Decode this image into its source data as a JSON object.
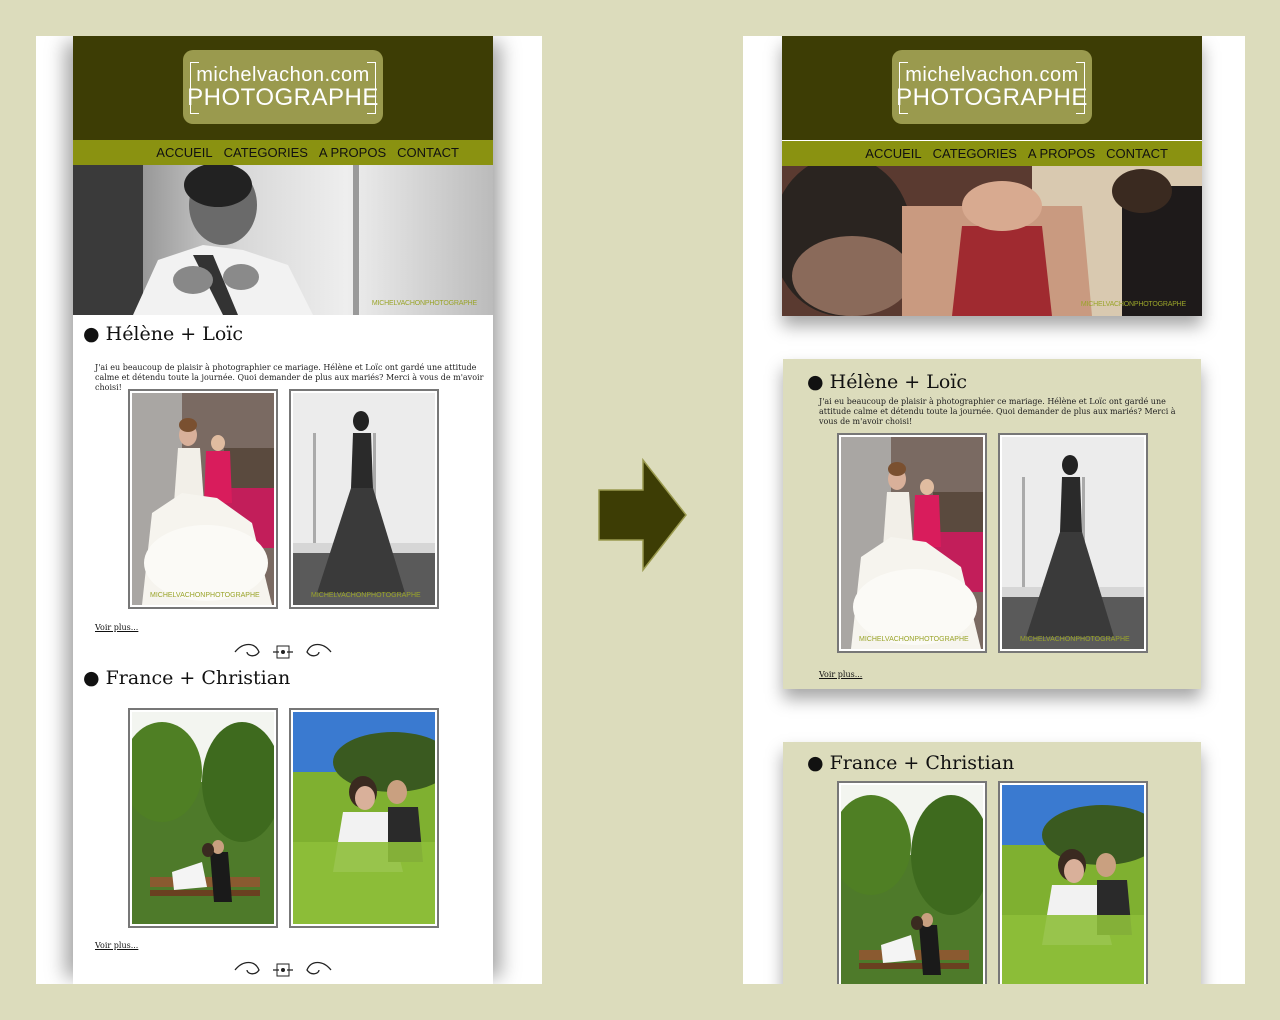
{
  "site": {
    "logo_top": "michelvachon.com",
    "logo_bottom": "PHOTOGRAPHE",
    "nav": [
      "ACCUEIL",
      "CATEGORIES",
      "A PROPOS",
      "CONTACT"
    ],
    "hero_watermark": "MICHELVACHONPHOTOGRAPHE",
    "photo_watermark": "MICHELVACHONPHOTOGRAPHE"
  },
  "posts": [
    {
      "title": "● Hélène + Loïc",
      "text": "J'ai eu beaucoup de plaisir à photographier ce mariage. Hélène et Loïc ont gardé une attitude calme et détendu toute la journée. Quoi demander de plus aux mariés? Merci à vous de m'avoir choisi!",
      "more": "Voir plus..."
    },
    {
      "title": "● France + Christian",
      "more": "Voir plus..."
    }
  ],
  "colors": {
    "background": "#dcdcbc",
    "header": "#3d3d05",
    "nav": "#8a9211",
    "logo": "#9a9a4e",
    "arrow": "#3d3d05"
  },
  "icons": [
    "right-arrow-icon",
    "ornament-divider-icon"
  ]
}
